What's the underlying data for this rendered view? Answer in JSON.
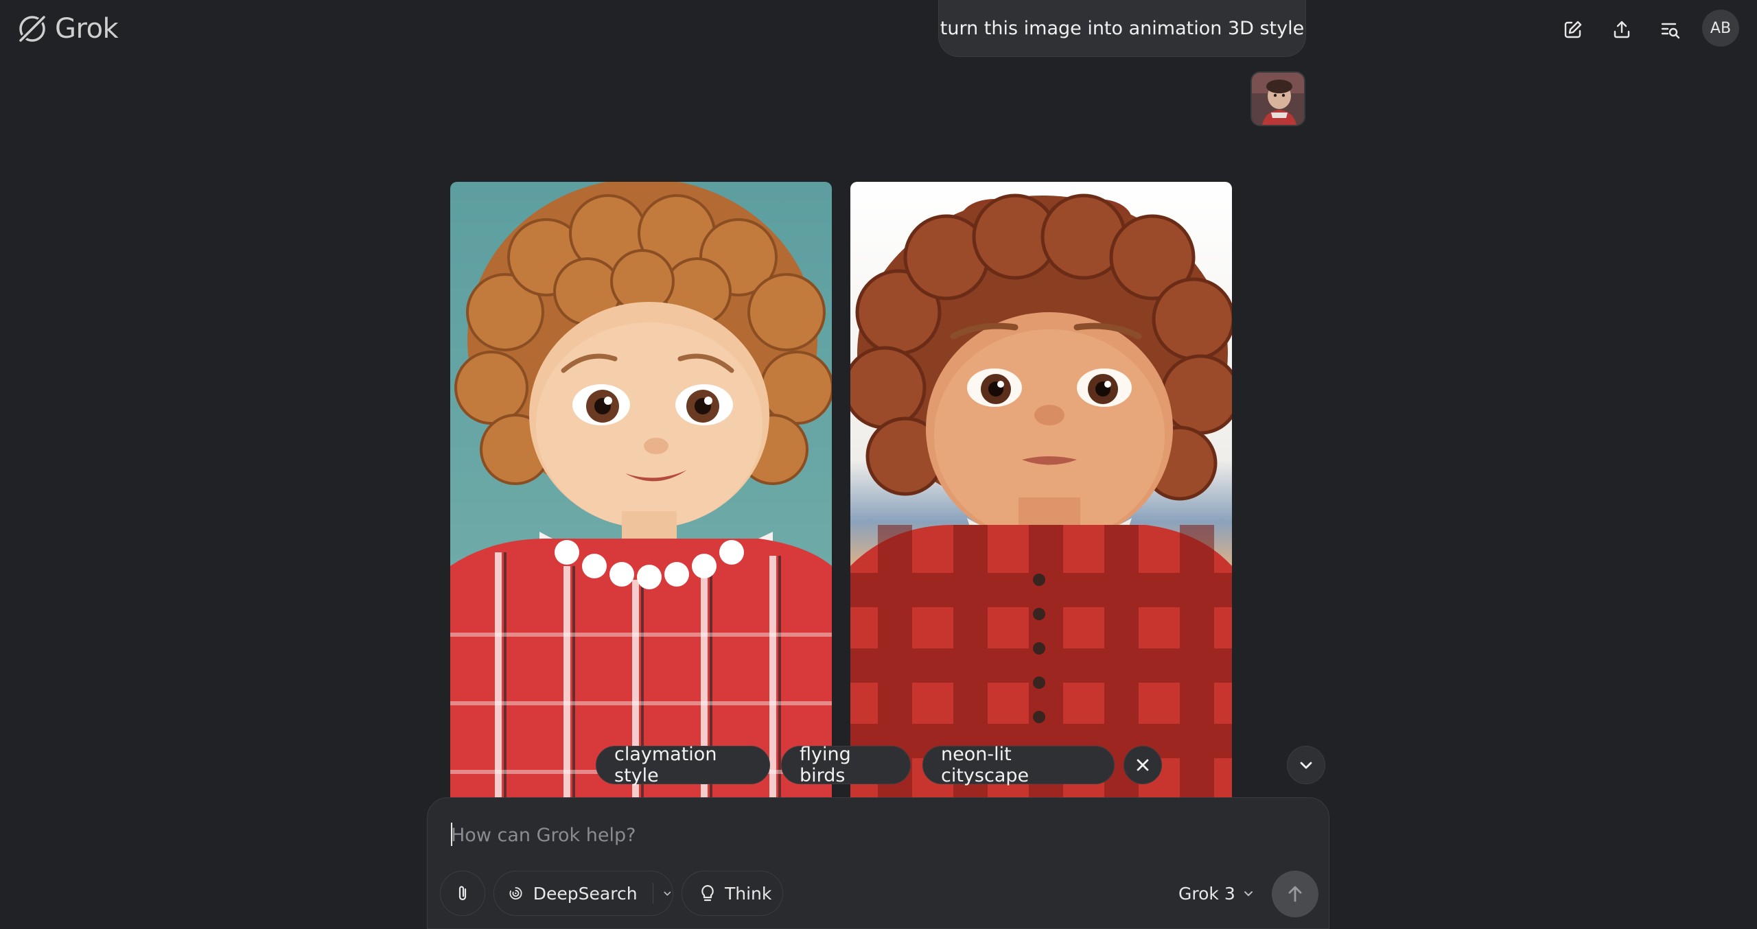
{
  "app": {
    "logo_text": "Grok"
  },
  "conversation": {
    "user_message": "turn this image into animation 3D style"
  },
  "header": {
    "avatar_initials": "AB",
    "icons": [
      "edit-icon",
      "share-icon",
      "search-history-icon"
    ]
  },
  "suggestions": [
    {
      "label": "claymation style"
    },
    {
      "label": "flying birds"
    },
    {
      "label": "neon-lit cityscape"
    }
  ],
  "composer": {
    "placeholder": "How can Grok help?",
    "value": "",
    "deepsearch_label": "DeepSearch",
    "think_label": "Think",
    "model_label": "Grok 3"
  },
  "colors": {
    "background": "#212225",
    "surface": "#2a2b2e",
    "chip": "#2f3033",
    "send_button": "#4a4b4f"
  }
}
